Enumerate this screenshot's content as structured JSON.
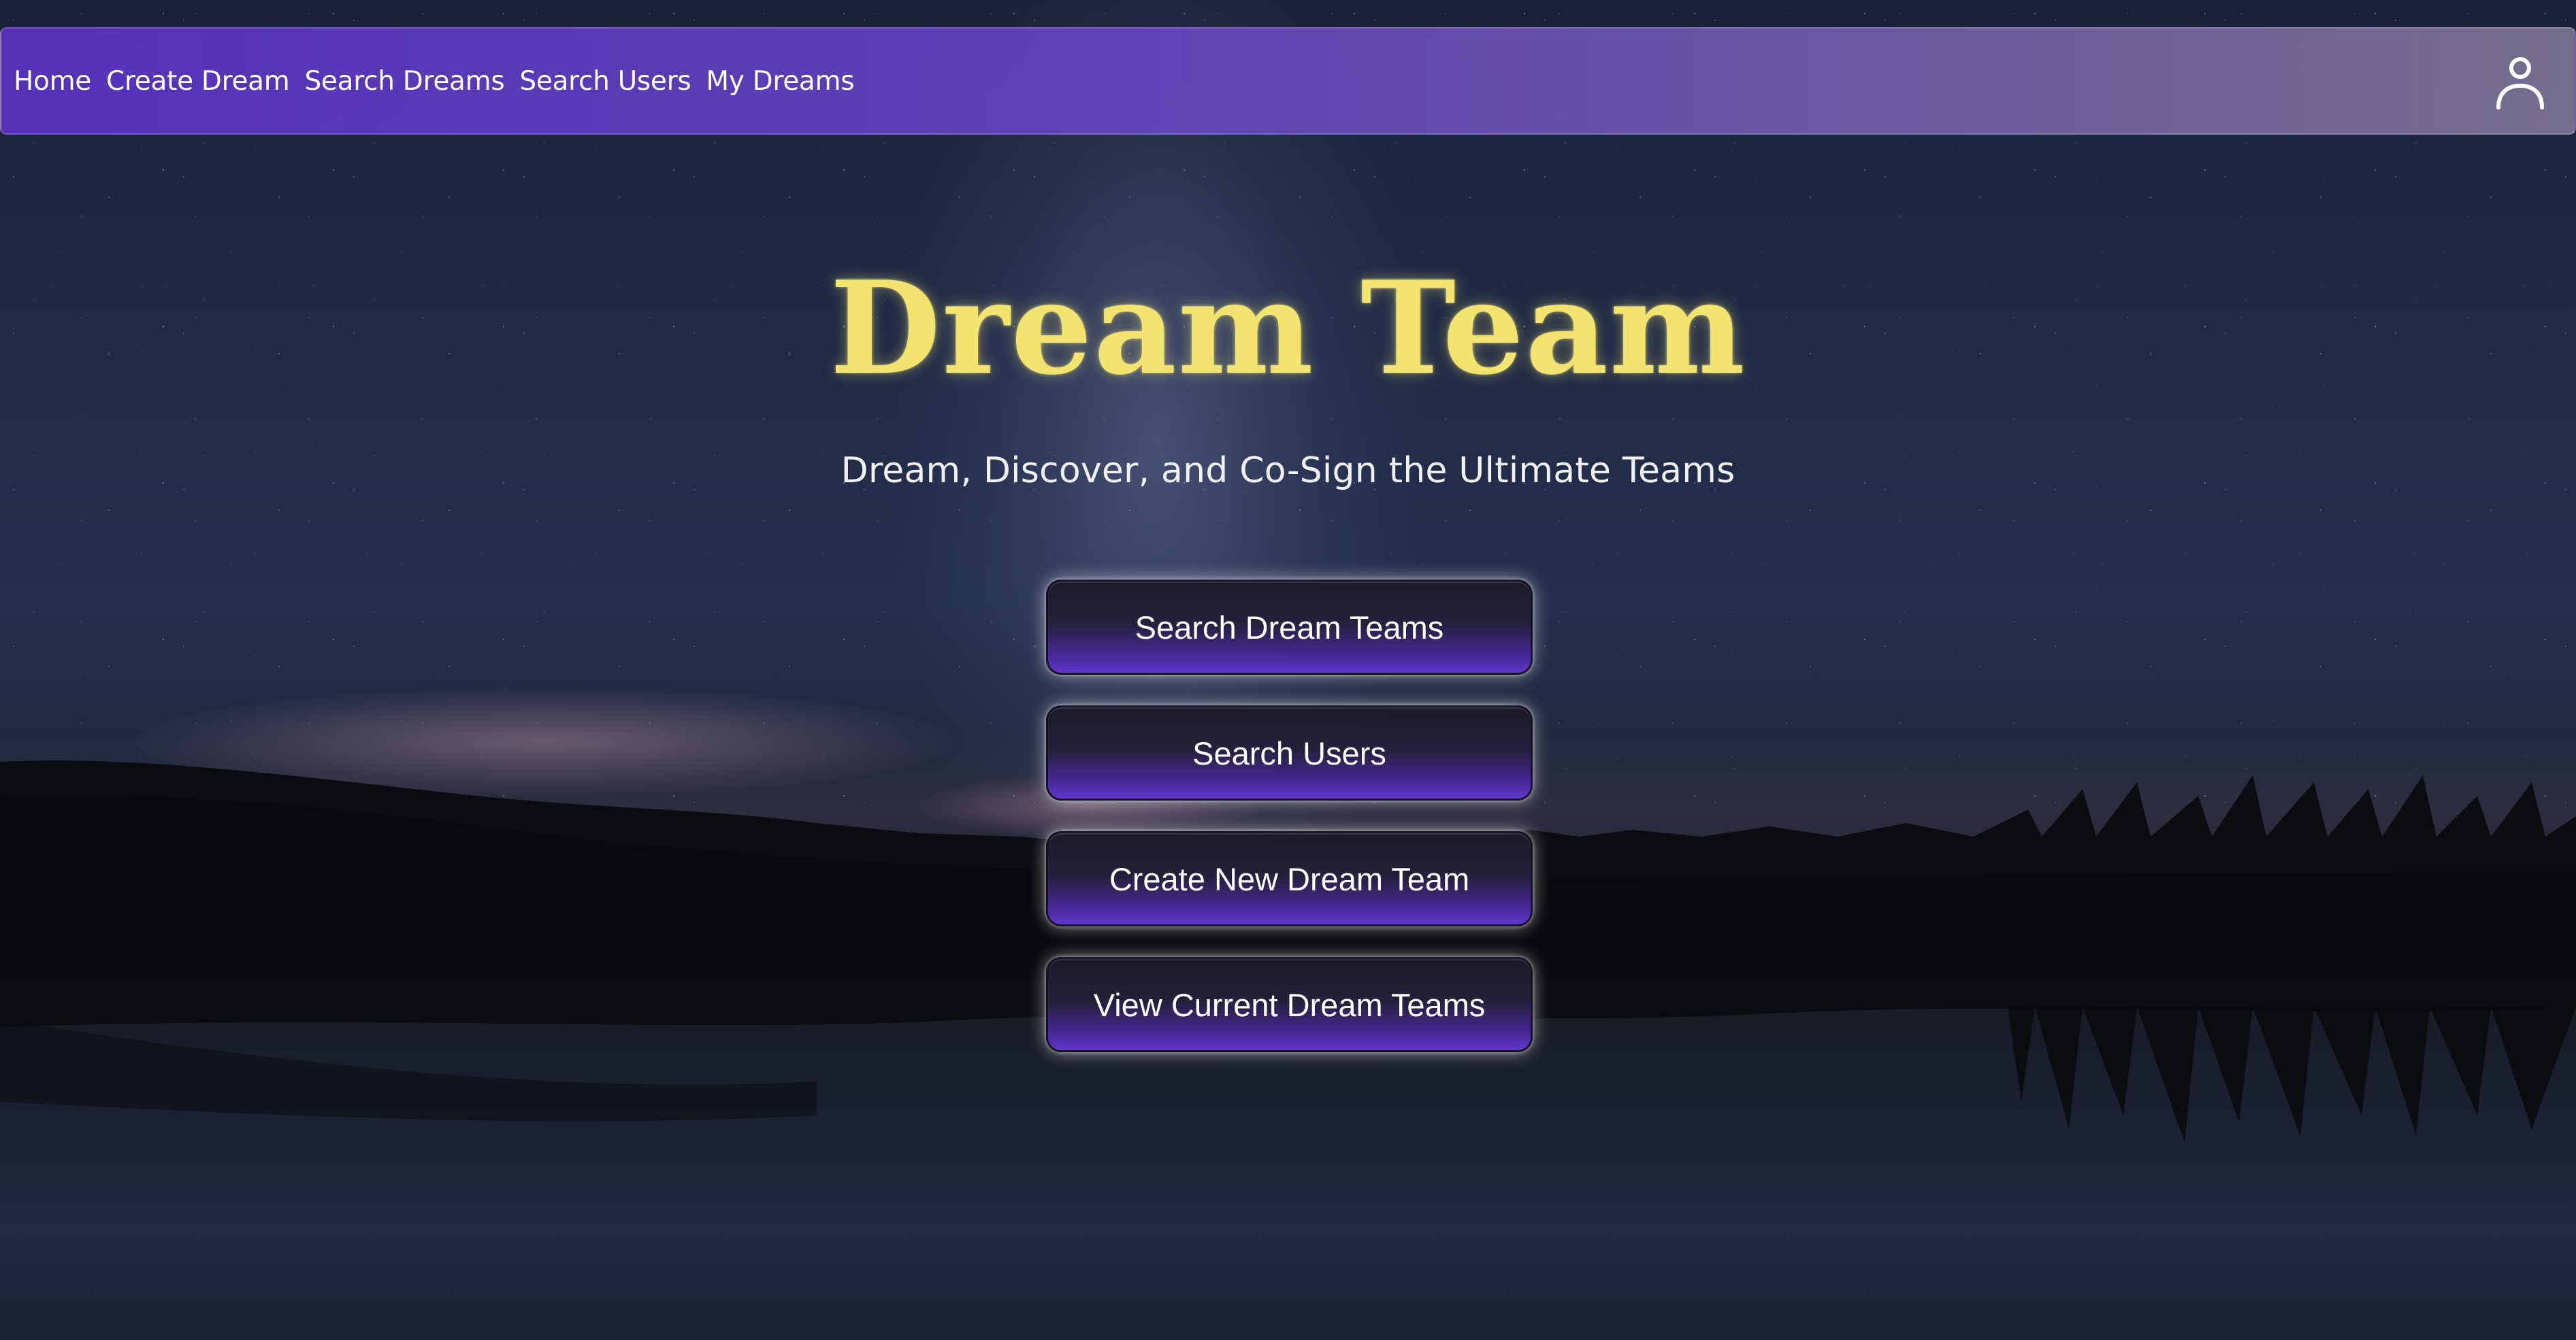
{
  "nav": {
    "links": [
      "Home",
      "Create Dream",
      "Search Dreams",
      "Search Users",
      "My Dreams"
    ],
    "user_icon": "user-icon"
  },
  "hero": {
    "title": "Dream Team",
    "subtitle": "Dream, Discover, and Co-Sign the Ultimate Teams"
  },
  "actions": {
    "buttons": [
      "Search Dream Teams",
      "Search Users",
      "Create New Dream Team",
      "View Current Dream Teams"
    ]
  },
  "colors": {
    "title": "#f2e46e",
    "nav_start": "#5832be",
    "nav_end": "#80769a",
    "button_accent": "#6237cd"
  }
}
